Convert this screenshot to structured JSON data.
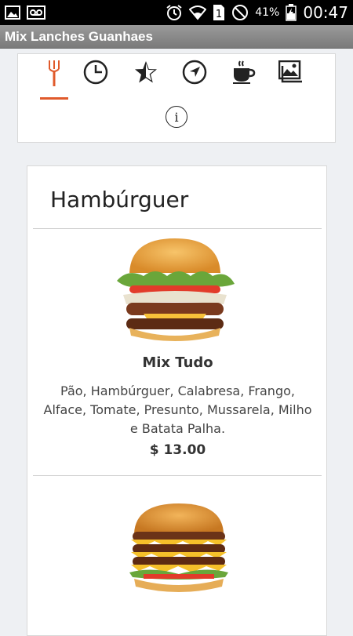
{
  "status_bar": {
    "battery_percent": "41%",
    "time": "00:47",
    "icons": [
      "image-icon",
      "voicemail-icon",
      "alarm-icon",
      "wifi-icon",
      "sim-1-icon",
      "do-not-disturb-icon",
      "battery-icon"
    ]
  },
  "app_bar": {
    "title": "Mix Lanches Guanhaes"
  },
  "nav": {
    "tabs": [
      {
        "name": "menu",
        "icon": "fork-icon",
        "active": true
      },
      {
        "name": "hours",
        "icon": "clock-icon",
        "active": false
      },
      {
        "name": "reviews",
        "icon": "star-icon",
        "active": false
      },
      {
        "name": "location",
        "icon": "navigation-arrow-icon",
        "active": false
      },
      {
        "name": "drinks",
        "icon": "coffee-cup-icon",
        "active": false
      },
      {
        "name": "gallery",
        "icon": "gallery-icon",
        "active": false
      }
    ],
    "info_label": "i"
  },
  "menu": {
    "category": "Hambúrguer",
    "items": [
      {
        "name": "Mix Tudo",
        "description": "Pão, Hambúrguer, Calabresa, Frango, Alface, Tomate, Presunto, Mussarela, Milho e Batata Palha.",
        "price": "$ 13.00"
      }
    ]
  },
  "colors": {
    "accent": "#e05a2b",
    "status_bar": "#000000",
    "app_bar": "#8a8a8a"
  }
}
